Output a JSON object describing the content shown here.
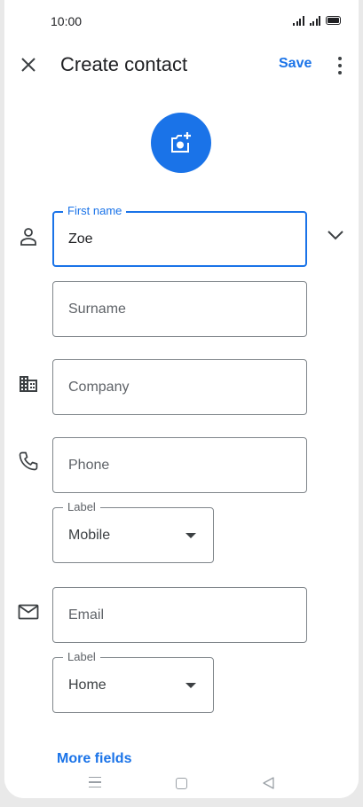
{
  "status_bar": {
    "time": "10:00"
  },
  "app_bar": {
    "title": "Create contact",
    "save_label": "Save"
  },
  "form": {
    "first_name": {
      "label": "First name",
      "value": "Zoe"
    },
    "surname": {
      "placeholder": "Surname"
    },
    "company": {
      "placeholder": "Company"
    },
    "phone": {
      "placeholder": "Phone"
    },
    "phone_label": {
      "label": "Label",
      "selected": "Mobile"
    },
    "email": {
      "placeholder": "Email"
    },
    "email_label": {
      "label": "Label",
      "selected": "Home"
    },
    "more_fields": "More fields"
  },
  "colors": {
    "accent": "#1a73e8",
    "outline": "#80868b",
    "text": "#202124",
    "muted": "#5f6368"
  },
  "icons": [
    "close-icon",
    "more-vert-icon",
    "add-photo-icon",
    "person-icon",
    "chevron-down-icon",
    "business-icon",
    "phone-icon",
    "email-icon",
    "dropdown-arrow-icon",
    "nav-menu-icon",
    "nav-home-icon",
    "nav-back-icon"
  ]
}
